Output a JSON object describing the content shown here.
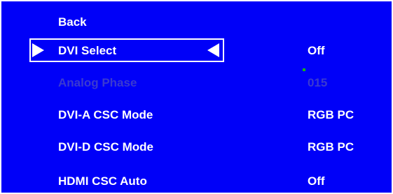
{
  "menu": {
    "back_label": "Back",
    "items": [
      {
        "label": "DVI Select",
        "value": "Off"
      },
      {
        "label": "Analog Phase",
        "value": "015"
      },
      {
        "label": "DVI-A CSC Mode",
        "value": "RGB PC"
      },
      {
        "label": "DVI-D CSC Mode",
        "value": "RGB PC"
      },
      {
        "label": "HDMI CSC Auto",
        "value": "Off"
      }
    ]
  },
  "colors": {
    "background": "#0000f8",
    "text": "#ffffff",
    "disabled_text": "#3a3ad0",
    "marker": "#18b418"
  },
  "icons": {
    "selection_left": "triangle-right-icon",
    "selection_right": "triangle-left-icon"
  }
}
